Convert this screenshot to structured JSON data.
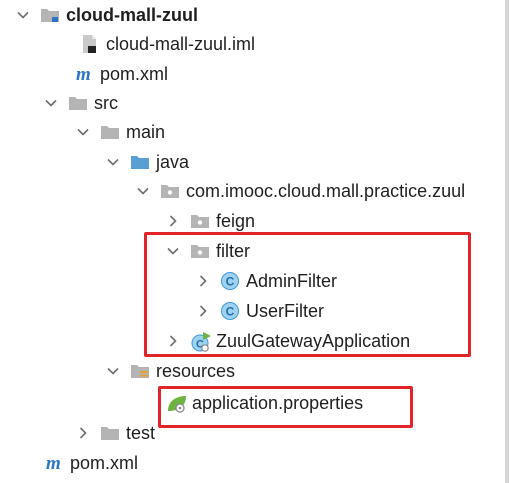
{
  "project_tree": {
    "root": {
      "label": "cloud-mall-zuul",
      "icon": "module-folder-icon",
      "expanded": true
    },
    "items": [
      {
        "label": "cloud-mall-zuul.iml",
        "icon": "iml-file-icon"
      },
      {
        "label": "pom.xml",
        "icon": "maven-icon"
      },
      {
        "label": "src",
        "icon": "folder-icon",
        "expanded": true
      },
      {
        "label": "main",
        "icon": "folder-icon",
        "expanded": true
      },
      {
        "label": "java",
        "icon": "source-folder-icon",
        "expanded": true
      },
      {
        "label": "com.imooc.cloud.mall.practice.zuul",
        "icon": "package-icon",
        "expanded": true
      },
      {
        "label": "feign",
        "icon": "package-icon",
        "expanded": false
      },
      {
        "label": "filter",
        "icon": "package-icon",
        "expanded": true
      },
      {
        "label": "AdminFilter",
        "icon": "class-icon",
        "expanded": false
      },
      {
        "label": "UserFilter",
        "icon": "class-icon",
        "expanded": false
      },
      {
        "label": "ZuulGatewayApplication",
        "icon": "spring-boot-class-icon",
        "expanded": false
      },
      {
        "label": "resources",
        "icon": "resources-folder-icon",
        "expanded": true
      },
      {
        "label": "application.properties",
        "icon": "spring-properties-icon"
      },
      {
        "label": "test",
        "icon": "folder-icon",
        "expanded": false
      },
      {
        "label": "pom.xml",
        "icon": "maven-icon"
      }
    ]
  },
  "colors": {
    "highlight_border": "#e0242a",
    "folder": "#b4b4b4",
    "source_folder": "#5a9fd4",
    "class_icon": "#3f9ad8",
    "maven": "#2b74c6",
    "spring": "#6db33f"
  }
}
